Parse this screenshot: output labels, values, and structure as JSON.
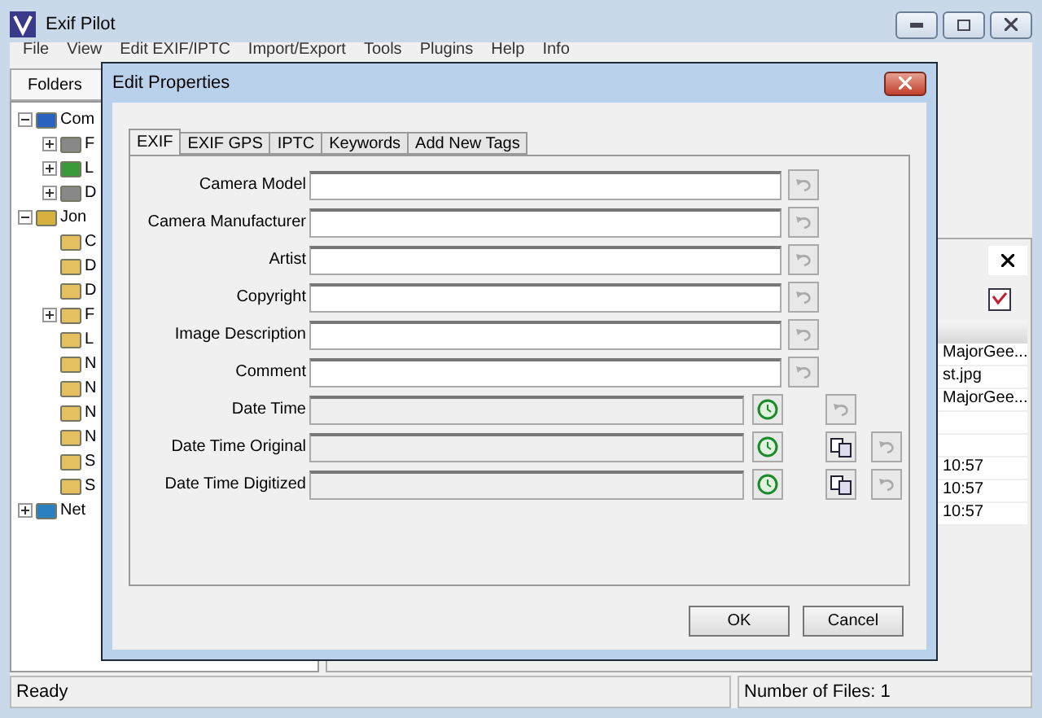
{
  "window": {
    "title": "Exif Pilot"
  },
  "menu": [
    "File",
    "View",
    "Edit EXIF/IPTC",
    "Import/Export",
    "Tools",
    "Plugins",
    "Help",
    "Info"
  ],
  "folders": {
    "title": "Folders",
    "tree": [
      {
        "label": "Com",
        "kind": "computer",
        "expanded": true,
        "children": [
          {
            "label": "F",
            "kind": "drive",
            "expanded": false
          },
          {
            "label": "L",
            "kind": "library",
            "expanded": false
          },
          {
            "label": "D",
            "kind": "drive",
            "expanded": false
          }
        ]
      },
      {
        "label": "Jon",
        "kind": "user",
        "expanded": true,
        "children": [
          {
            "label": "C",
            "kind": "folder"
          },
          {
            "label": "D",
            "kind": "folder"
          },
          {
            "label": "D",
            "kind": "folder"
          },
          {
            "label": "F",
            "kind": "folder",
            "expanded": false
          },
          {
            "label": "L",
            "kind": "folder"
          },
          {
            "label": "N",
            "kind": "folder"
          },
          {
            "label": "N",
            "kind": "folder"
          },
          {
            "label": "N",
            "kind": "folder"
          },
          {
            "label": "N",
            "kind": "folder"
          },
          {
            "label": "S",
            "kind": "folder"
          },
          {
            "label": "S",
            "kind": "folder"
          }
        ]
      },
      {
        "label": "Net",
        "kind": "network",
        "expanded": false
      }
    ]
  },
  "files_panel": {
    "rows": [
      "MajorGee...",
      "st.jpg",
      "MajorGee...",
      "",
      "",
      "10:57",
      "10:57",
      "10:57"
    ]
  },
  "status_bar": {
    "left": "Ready",
    "right": "Number of Files: 1"
  },
  "dialog": {
    "title": "Edit Properties",
    "tabs": [
      {
        "label": "EXIF",
        "selected": true
      },
      {
        "label": "EXIF GPS",
        "selected": false
      },
      {
        "label": "IPTC",
        "selected": false
      },
      {
        "label": "Keywords",
        "selected": false
      },
      {
        "label": "Add New Tags",
        "selected": false
      }
    ],
    "fields": [
      {
        "label": "Camera Model",
        "kind": "text"
      },
      {
        "label": "Camera Manufacturer",
        "kind": "text"
      },
      {
        "label": "Artist",
        "kind": "text"
      },
      {
        "label": "Copyright",
        "kind": "text"
      },
      {
        "label": "Image Description",
        "kind": "text"
      },
      {
        "label": "Comment",
        "kind": "text"
      },
      {
        "label": "Date Time",
        "kind": "date",
        "copy": false
      },
      {
        "label": "Date Time Original",
        "kind": "date",
        "copy": true
      },
      {
        "label": "Date Time Digitized",
        "kind": "date",
        "copy": true
      }
    ],
    "buttons": [
      "OK",
      "Cancel"
    ]
  }
}
